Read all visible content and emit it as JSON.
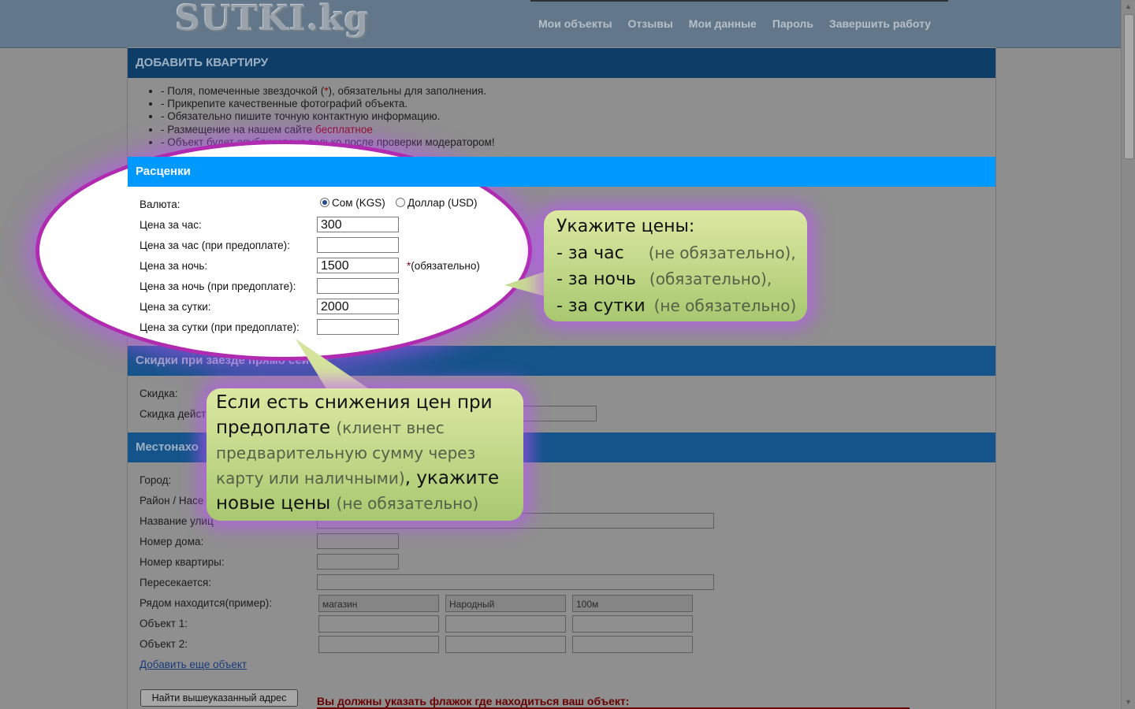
{
  "site": {
    "logo": "SUTKI.kg",
    "nav": [
      "Мои объекты",
      "Отзывы",
      "Мои данные",
      "Пароль",
      "Завершить работу"
    ]
  },
  "page": {
    "title": "ДОБАВИТЬ КВАРТИРУ",
    "notes": [
      {
        "text": "- Поля, помеченные звездочкой (",
        "red": "*",
        "tail": "), обязательны для заполнения."
      },
      {
        "text": "- Прикрепите качественные фотографий объекта.",
        "red": "",
        "tail": ""
      },
      {
        "text": "- Обязательно пишите точную контактную информацию.",
        "red": "",
        "tail": ""
      },
      {
        "text": "- Размещение на нашем сайте ",
        "red": "бесплатное",
        "tail": ""
      },
      {
        "text": "- Объект будет опубликована только после проверки модератором!",
        "red": "",
        "tail": ""
      }
    ]
  },
  "pricing": {
    "header": "Расценки",
    "currency_label": "Валюта:",
    "currency_options": [
      "Сом (KGS)",
      "Доллар (USD)"
    ],
    "selected_currency": "Сом (KGS)",
    "rows": [
      {
        "label": "Цена за час:",
        "value": "300",
        "note": ""
      },
      {
        "label": "Цена за час (при предоплате):",
        "value": "",
        "note": ""
      },
      {
        "label": "Цена за ночь:",
        "value": "1500",
        "note": "(обязательно)",
        "star": "*"
      },
      {
        "label": "Цена за ночь (при предоплате):",
        "value": "",
        "note": ""
      },
      {
        "label": "Цена за сутки:",
        "value": "2000",
        "note": ""
      },
      {
        "label": "Цена за сутки (при предоплате):",
        "value": "",
        "note": ""
      }
    ]
  },
  "discounts": {
    "header": "Скидки при заезде прямо сейчас",
    "labels": [
      "Скидка:",
      "Скидка действ"
    ]
  },
  "location": {
    "header": "Местонахо",
    "labels": [
      "Город:",
      "Район / Насе",
      "Название улиц",
      "Номер дома:",
      "Номер квартиры:",
      "Пересекается:",
      "Рядом находится(пример):",
      "Объект 1:",
      "Объект 2:"
    ],
    "example_placeholders": [
      "магазин",
      "Народный",
      "100м"
    ],
    "add_link": "Добавить еще объект",
    "find_button": "Найти вышеуказанный адрес",
    "warning": "Вы должны указать флажок где находиться ваш объект:"
  },
  "callout_prices": {
    "line1": "Укажите цены:",
    "items": [
      {
        "main": "- за час",
        "note": "(не обязательно),"
      },
      {
        "main": "- за ночь",
        "note": "(обязательно),"
      },
      {
        "main": "- за сутки",
        "note": "(не обязательно)"
      }
    ]
  },
  "callout_prepay": {
    "main1": "Если есть снижения цен при предоплате ",
    "grey1": "(клиент внес предварительную сумму через карту или наличными)",
    "main2": ", укажите новые цены ",
    "grey2": "(не обязательно)"
  }
}
